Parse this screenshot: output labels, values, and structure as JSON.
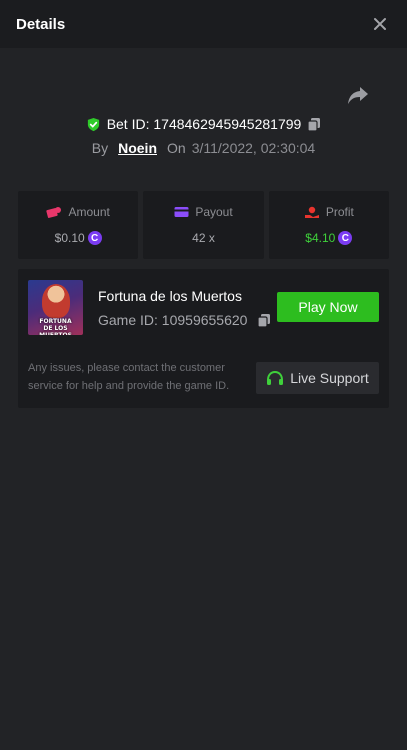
{
  "header": {
    "title": "Details",
    "close_icon": "close-icon"
  },
  "share_icon": "share-icon",
  "bet": {
    "verified_icon": "shield-check-icon",
    "bet_id_label": "Bet ID: 1748462945945281799",
    "copy_icon": "copy-icon",
    "by_label": "By",
    "user": "Noein",
    "on_label": "On",
    "datetime": "3/11/2022, 02:30:04"
  },
  "stats": [
    {
      "label": "Amount",
      "value": "$0.10",
      "icon": "money-icon",
      "coin": "C"
    },
    {
      "label": "Payout",
      "value": "42 x",
      "icon": "card-icon"
    },
    {
      "label": "Profit",
      "value": "$4.10",
      "icon": "profit-hand-icon",
      "coin": "C"
    }
  ],
  "game": {
    "thumb_line1": "FORTUNA",
    "thumb_line2": "DE LOS MUERTOS",
    "name": "Fortuna de los Muertos",
    "id_label": "Game ID: 10959655620",
    "play_label": "Play Now",
    "support_text": "Any issues, please contact the customer service for help and provide the game ID.",
    "support_label": "Live Support"
  },
  "colors": {
    "background": "#222326",
    "header": "#1b1c1f",
    "card": "#1a1b1e",
    "accent_green": "#2dbd1f",
    "profit_green": "#3fd13b",
    "coin_purple": "#7b3cf2",
    "amount_pink": "#e8376b",
    "payout_purple": "#8b4dfa",
    "profit_red": "#e8342e"
  }
}
